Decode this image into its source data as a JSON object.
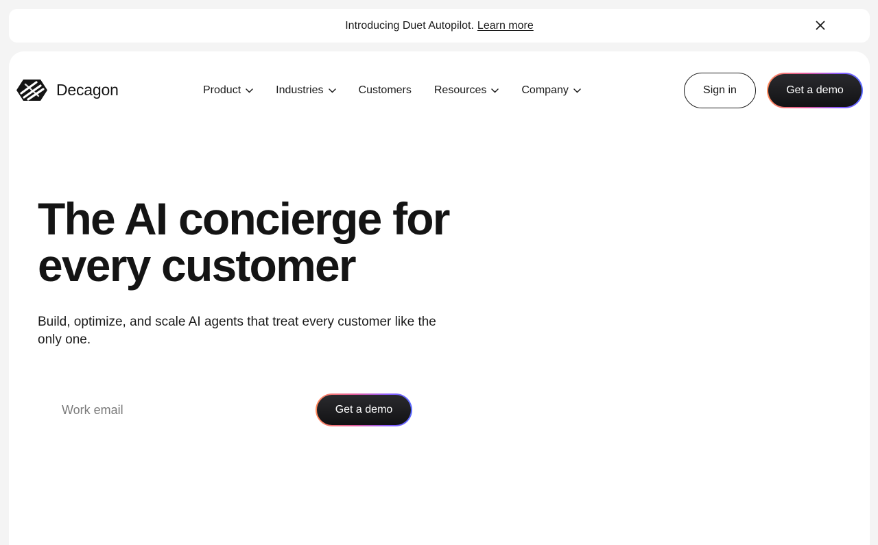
{
  "banner": {
    "text": "Introducing Duet Autopilot.",
    "link": "Learn more",
    "close_icon": "close-icon"
  },
  "nav": {
    "brand": "Decagon",
    "logo_icon": "decagon-logo-icon",
    "items": [
      {
        "label": "Product",
        "has_dropdown": true
      },
      {
        "label": "Industries",
        "has_dropdown": true
      },
      {
        "label": "Customers",
        "has_dropdown": false
      },
      {
        "label": "Resources",
        "has_dropdown": true
      },
      {
        "label": "Company",
        "has_dropdown": true
      }
    ],
    "signin_label": "Sign in",
    "demo_label": "Get a demo"
  },
  "hero": {
    "title": "The AI concierge for every customer",
    "subtitle": "Build, optimize, and scale AI agents that treat every customer like the only one.",
    "email_placeholder": "Work email",
    "email_value": "",
    "demo_label": "Get a demo"
  },
  "colors": {
    "page_bg": "#f4f4f4",
    "card_bg": "#ffffff",
    "text": "#141414",
    "button_dark": "#141414",
    "gradient_border": [
      "#ff8a5b",
      "#e25a9a",
      "#8a5cff",
      "#5a6bff"
    ]
  }
}
